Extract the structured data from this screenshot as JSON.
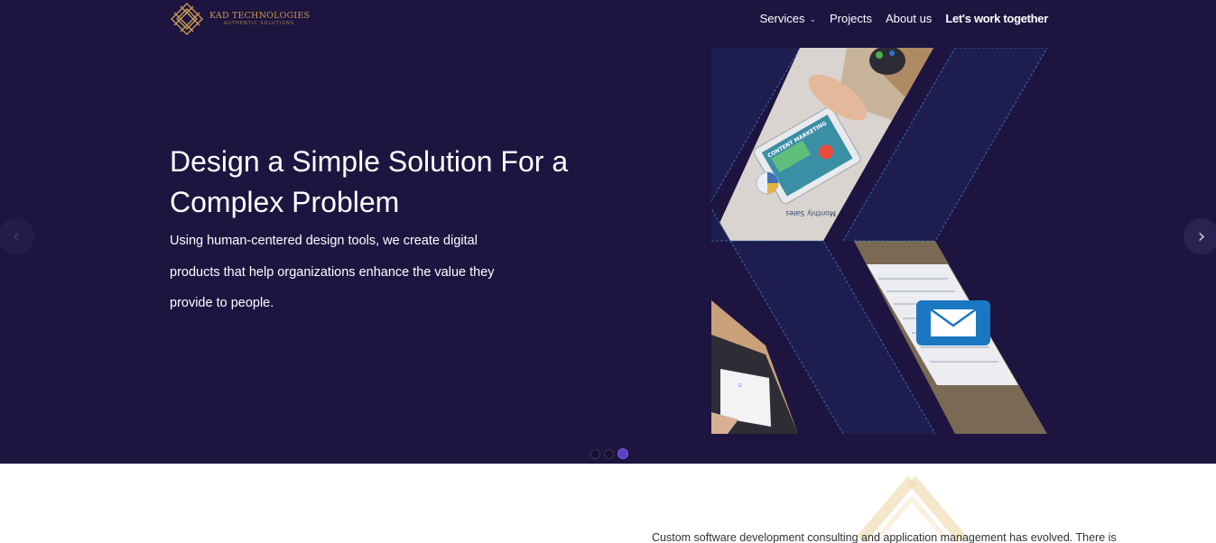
{
  "header": {
    "logo_name": "KAD TECHNOLOGIES",
    "logo_tagline": "AUTHENTIC SOLUTIONS",
    "nav": {
      "services": "Services",
      "projects": "Projects",
      "about": "About us",
      "cta": "Let's work together"
    }
  },
  "hero": {
    "headline_line1": "Design a Simple Solution For a",
    "headline_line2": "Complex Problem",
    "subtext_line1": "Using human-centered design tools, we create digital",
    "subtext_line2": "products that help organizations enhance the value they",
    "subtext_line3": "provide to people.",
    "image_text_content": "CONTENT MARKETING",
    "image_text_sales": "Monthly Sales"
  },
  "carousel": {
    "prev_glyph": "‹",
    "next_glyph": "›",
    "slide_count": 3,
    "active_slide": 3
  },
  "lower": {
    "intro_text": "Custom software development consulting and application management has evolved. There is"
  },
  "colors": {
    "hero_bg": "#1d1440",
    "logo_gold": "#c89a4e",
    "active_dot": "#5b3fc4",
    "panel_navy": "#1e1d4f"
  }
}
